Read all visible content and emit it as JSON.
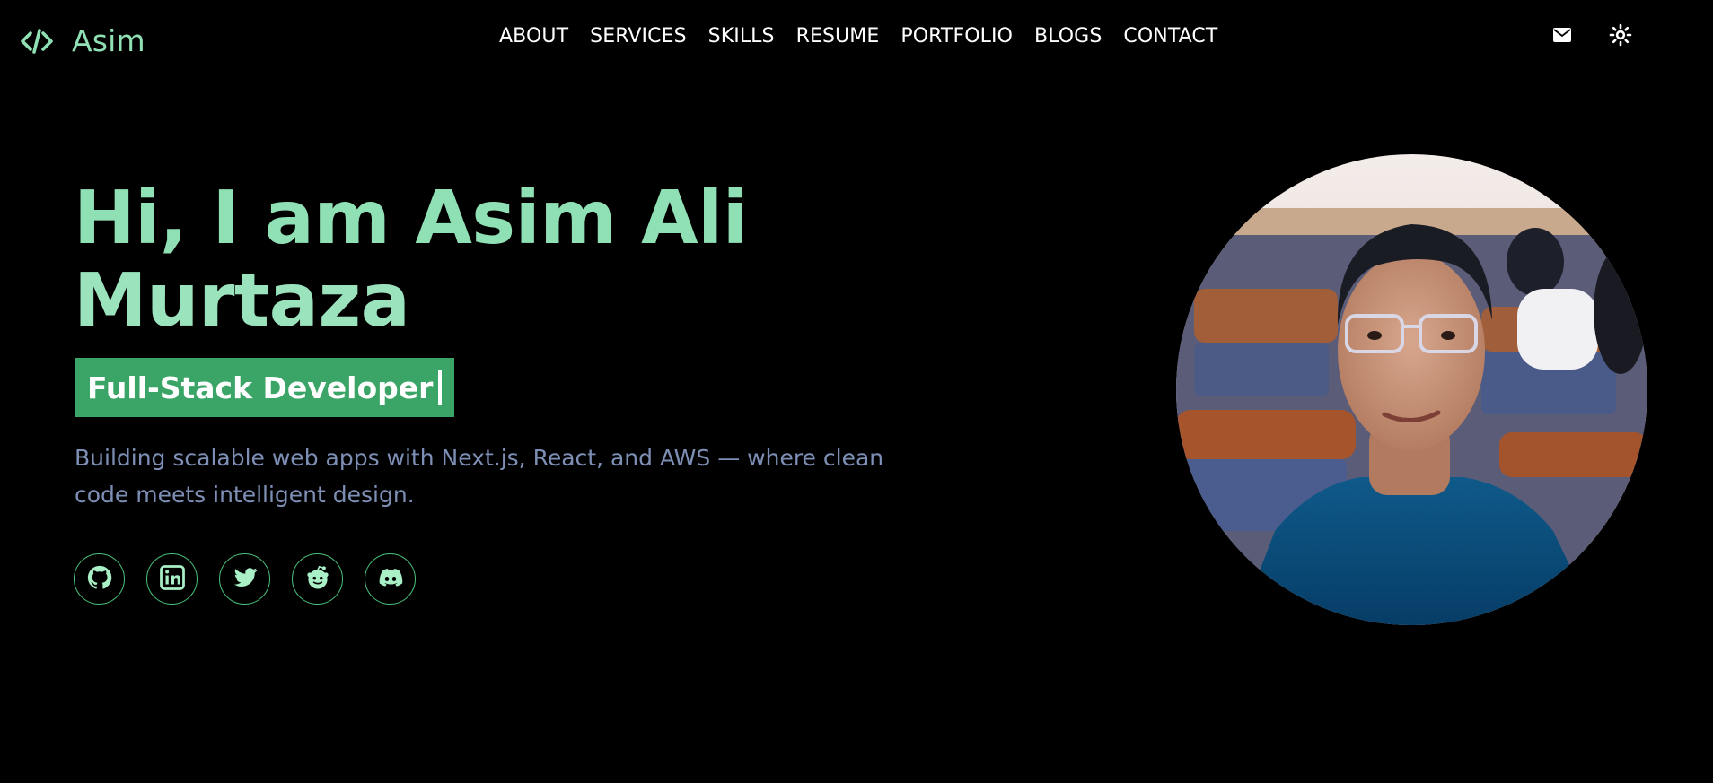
{
  "brand": {
    "name": "Asim",
    "icon": "code-brackets-icon",
    "accent": "#8fe0b4"
  },
  "nav": {
    "items": [
      "ABOUT",
      "SERVICES",
      "SKILLS",
      "RESUME",
      "PORTFOLIO",
      "BLOGS",
      "CONTACT"
    ]
  },
  "header_actions": {
    "mail_icon": "mail-icon",
    "theme_icon": "sun-icon"
  },
  "hero": {
    "title_line1": "Hi, I am Asim Ali",
    "title_line2": "Murtaza",
    "role": "Full-Stack Developer",
    "description": "Building scalable web apps with Next.js, React, and AWS — where clean code meets intelligent design.",
    "role_bg": "#3aa566",
    "title_color": "#90e0b5",
    "description_color": "#7e8fb6"
  },
  "socials": [
    "github-icon",
    "linkedin-icon",
    "twitter-icon",
    "reddit-icon",
    "discord-icon"
  ],
  "portrait": {
    "subject": "portrait-photo"
  }
}
